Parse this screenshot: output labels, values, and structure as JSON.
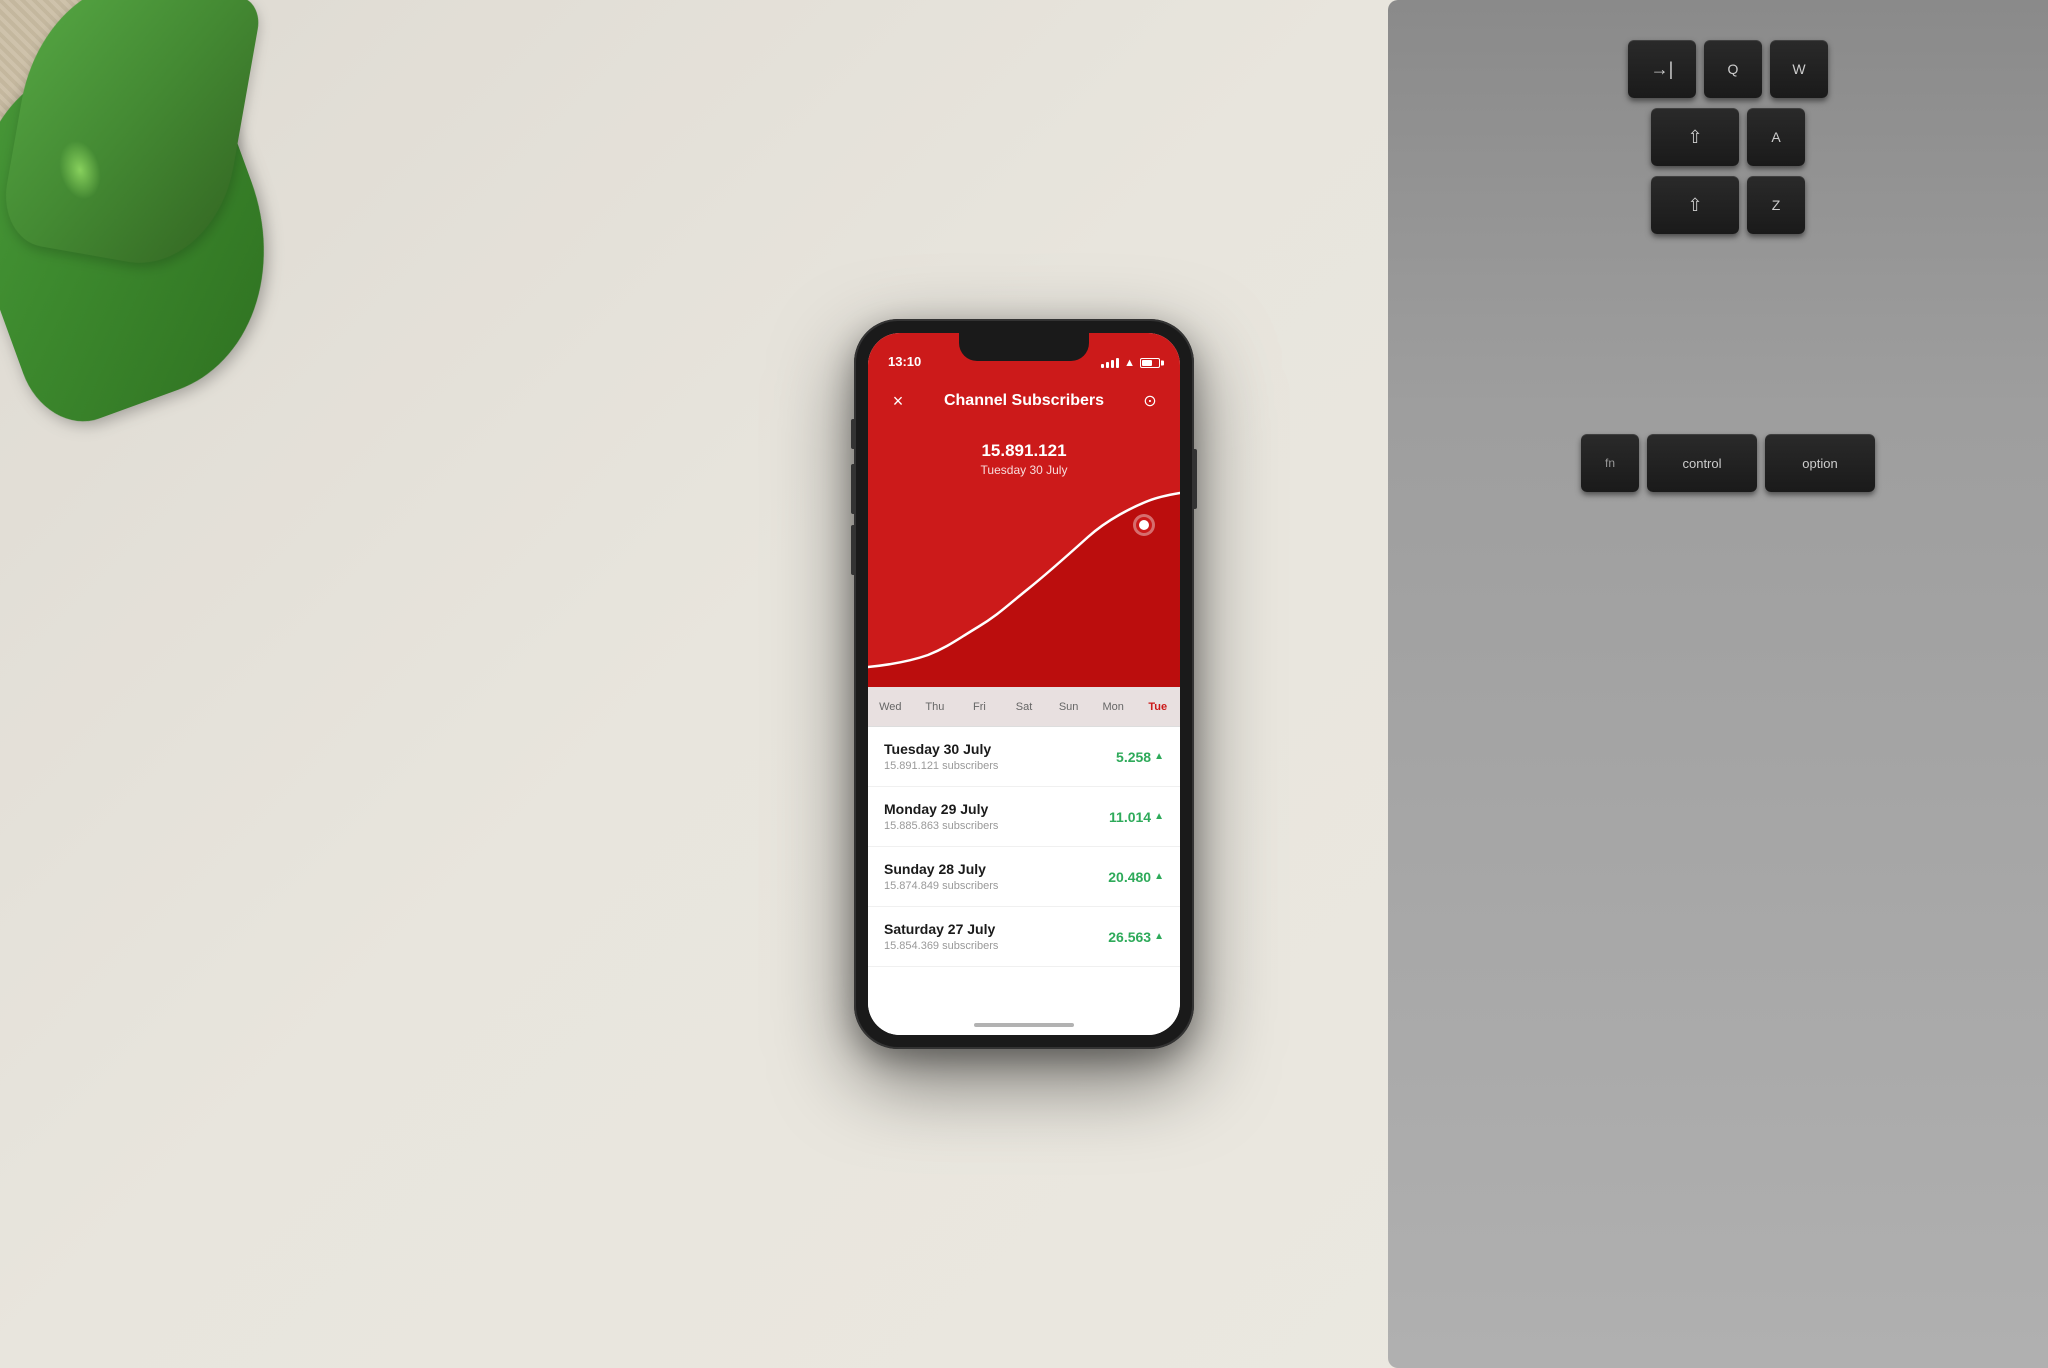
{
  "desk": {
    "background": "#e8e5dd"
  },
  "phone": {
    "status_bar": {
      "time": "13:10",
      "signal": "●●●●",
      "wifi": "WiFi",
      "battery": "60%"
    },
    "header": {
      "title": "Channel Subscribers",
      "close_icon": "×",
      "camera_icon": "📷"
    },
    "chart": {
      "tooltip_value": "15.891.121",
      "tooltip_date": "Tuesday 30 July"
    },
    "day_labels": [
      "Wed",
      "Thu",
      "Fri",
      "Sat",
      "Sun",
      "Mon",
      "Tue"
    ],
    "active_day": "Tue",
    "stats": [
      {
        "date": "Tuesday 30 July",
        "subscribers": "15.891.121 subscribers",
        "change": "5.258",
        "trend": "up"
      },
      {
        "date": "Monday 29 July",
        "subscribers": "15.885.863 subscribers",
        "change": "11.014",
        "trend": "up"
      },
      {
        "date": "Sunday 28 July",
        "subscribers": "15.874.849 subscribers",
        "change": "20.480",
        "trend": "up"
      },
      {
        "date": "Saturday 27 July",
        "subscribers": "15.854.369 subscribers",
        "change": "26.563",
        "trend": "up"
      }
    ]
  },
  "keyboard": {
    "rows": [
      [
        "→|",
        "Q",
        "W"
      ],
      [
        "⇧",
        "A"
      ],
      [
        "⇧",
        "Z"
      ],
      [
        "fn",
        "control",
        "option"
      ]
    ]
  }
}
